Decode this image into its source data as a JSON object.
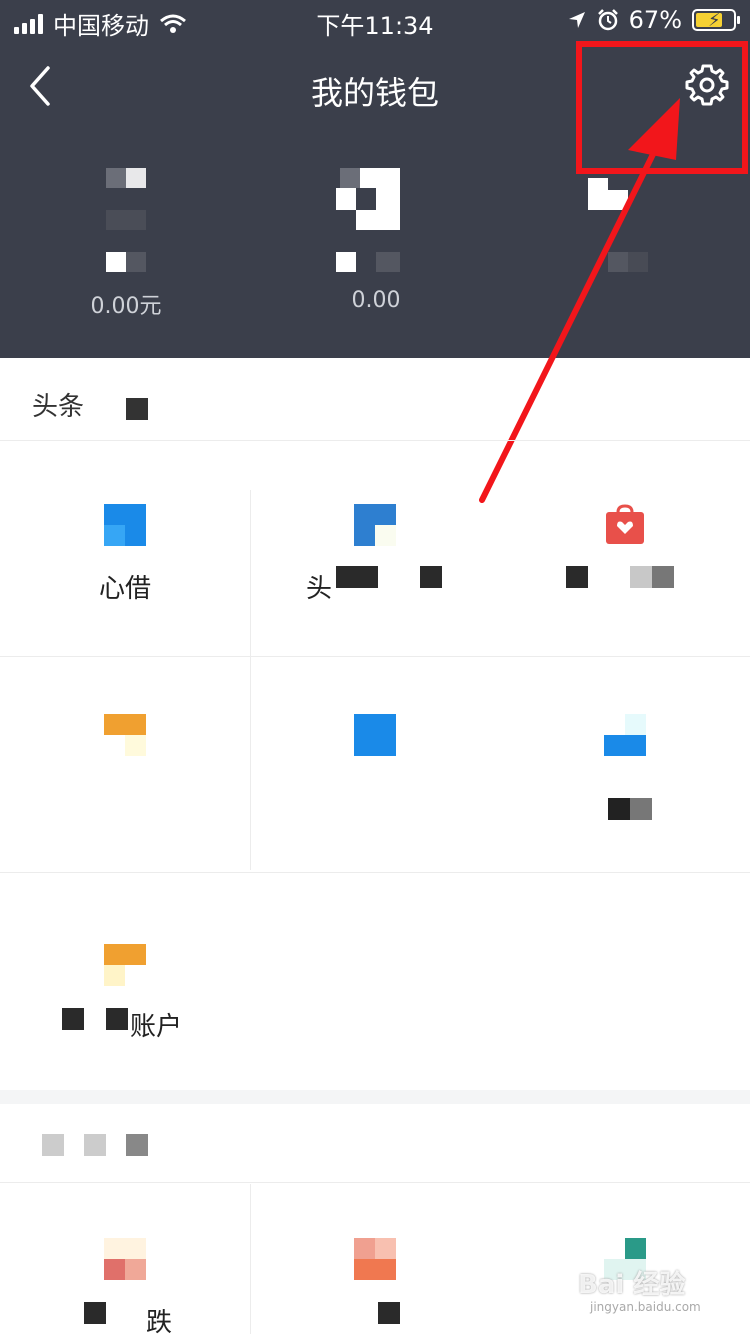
{
  "status_bar": {
    "carrier": "中国移动",
    "time": "下午11:34",
    "battery": "67%"
  },
  "nav": {
    "title": "我的钱包"
  },
  "balances": [
    {
      "amount": "0.00元"
    },
    {
      "amount": "0.00"
    },
    {
      "amount": ""
    }
  ],
  "section1": {
    "title": "头条"
  },
  "grid1": [
    {
      "label": "心借"
    },
    {
      "label": "头"
    },
    {
      "label": ""
    },
    {
      "label": ""
    },
    {
      "label": ""
    },
    {
      "label": ""
    },
    {
      "label": "账户"
    }
  ],
  "grid2": [
    {
      "label": "跌"
    },
    {
      "label": ""
    },
    {
      "label": ""
    }
  ],
  "watermark": {
    "text": "Bai 经验",
    "sub": "jingyan.baidu.com"
  },
  "colors": {
    "header_bg": "#3b3f4b",
    "highlight": "#f2161b",
    "accent_blue": "#1a8ae8",
    "accent_orange": "#f0a030",
    "accent_red": "#e8504a"
  }
}
